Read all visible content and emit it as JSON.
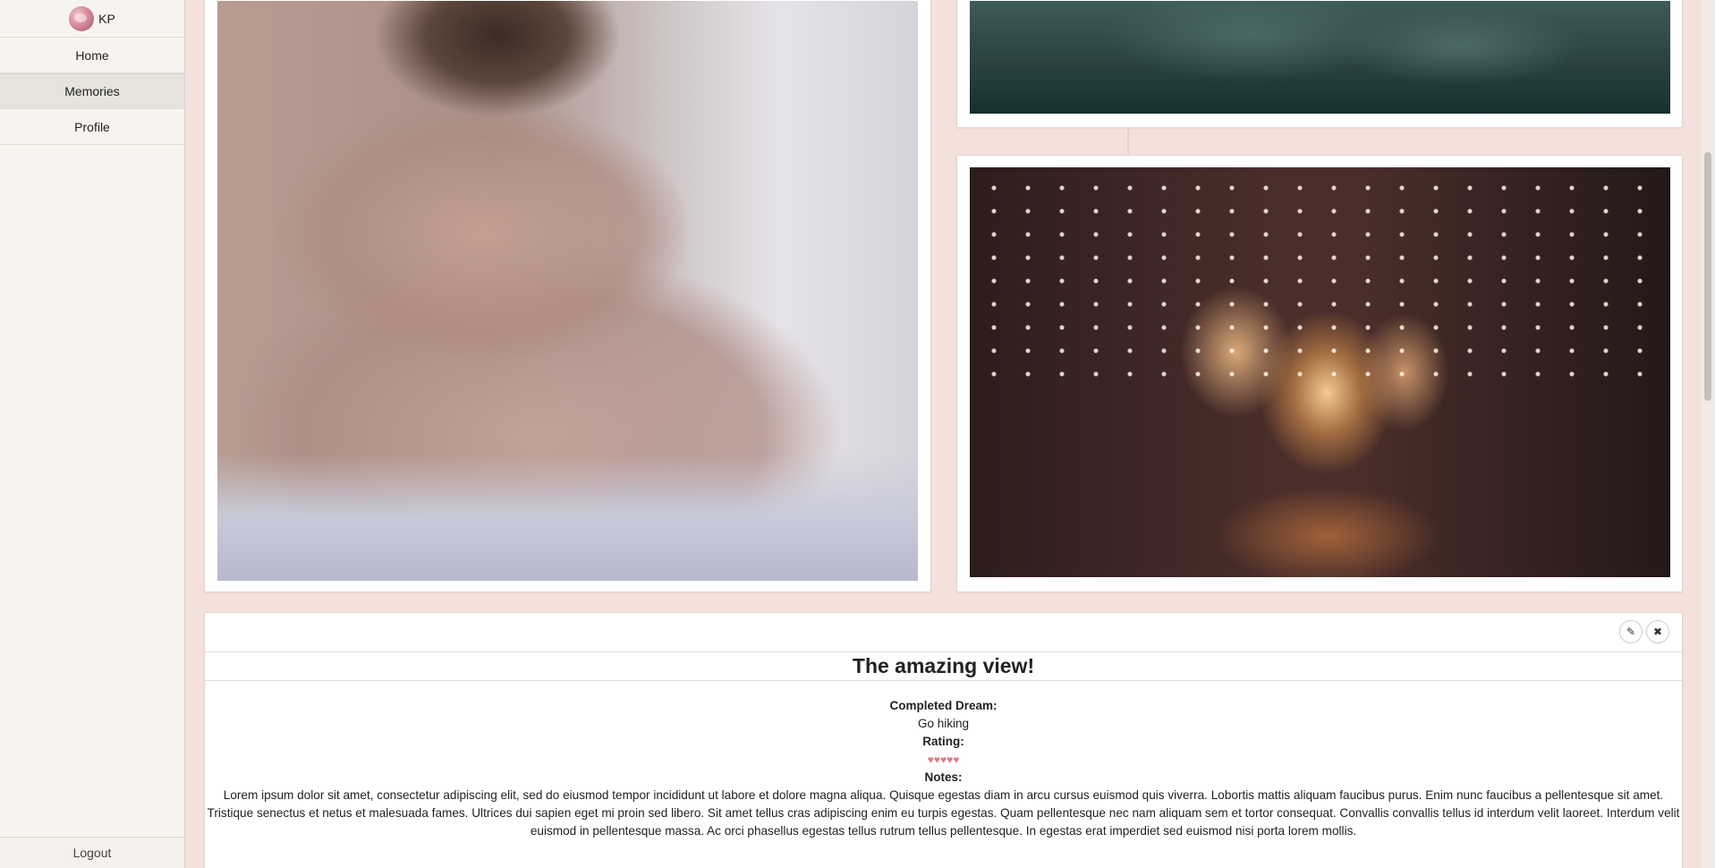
{
  "sidebar": {
    "user_initials": "KP",
    "items": [
      {
        "label": "Home"
      },
      {
        "label": "Memories"
      },
      {
        "label": "Profile"
      }
    ],
    "logout_label": "Logout"
  },
  "memory": {
    "title": "The amazing view!",
    "completed_dream_label": "Completed Dream:",
    "completed_dream_value": "Go hiking",
    "rating_label": "Rating:",
    "rating_value": "♥♥♥♥♥",
    "notes_label": "Notes:",
    "notes_text": "Lorem ipsum dolor sit amet, consectetur adipiscing elit, sed do eiusmod tempor incididunt ut labore et dolore magna aliqua. Quisque egestas diam in arcu cursus euismod quis viverra. Lobortis mattis aliquam faucibus purus. Enim nunc faucibus a pellentesque sit amet. Tristique senectus et netus et malesuada fames. Ultrices dui sapien eget mi proin sed libero. Sit amet tellus cras adipiscing enim eu turpis egestas. Quam pellentesque nec nam aliquam sem et tortor consequat. Convallis convallis tellus id interdum velit laoreet. Interdum velit euismod in pellentesque massa. Ac orci phasellus egestas tellus rutrum tellus pellentesque. In egestas erat imperdiet sed euismod nisi porta lorem mollis."
  },
  "icons": {
    "edit": "pencil-icon",
    "close": "close-icon"
  },
  "colors": {
    "page_background": "#f5e1dc",
    "sidebar_background": "#f7f4ef",
    "rating_hearts": "#e07a8a"
  }
}
